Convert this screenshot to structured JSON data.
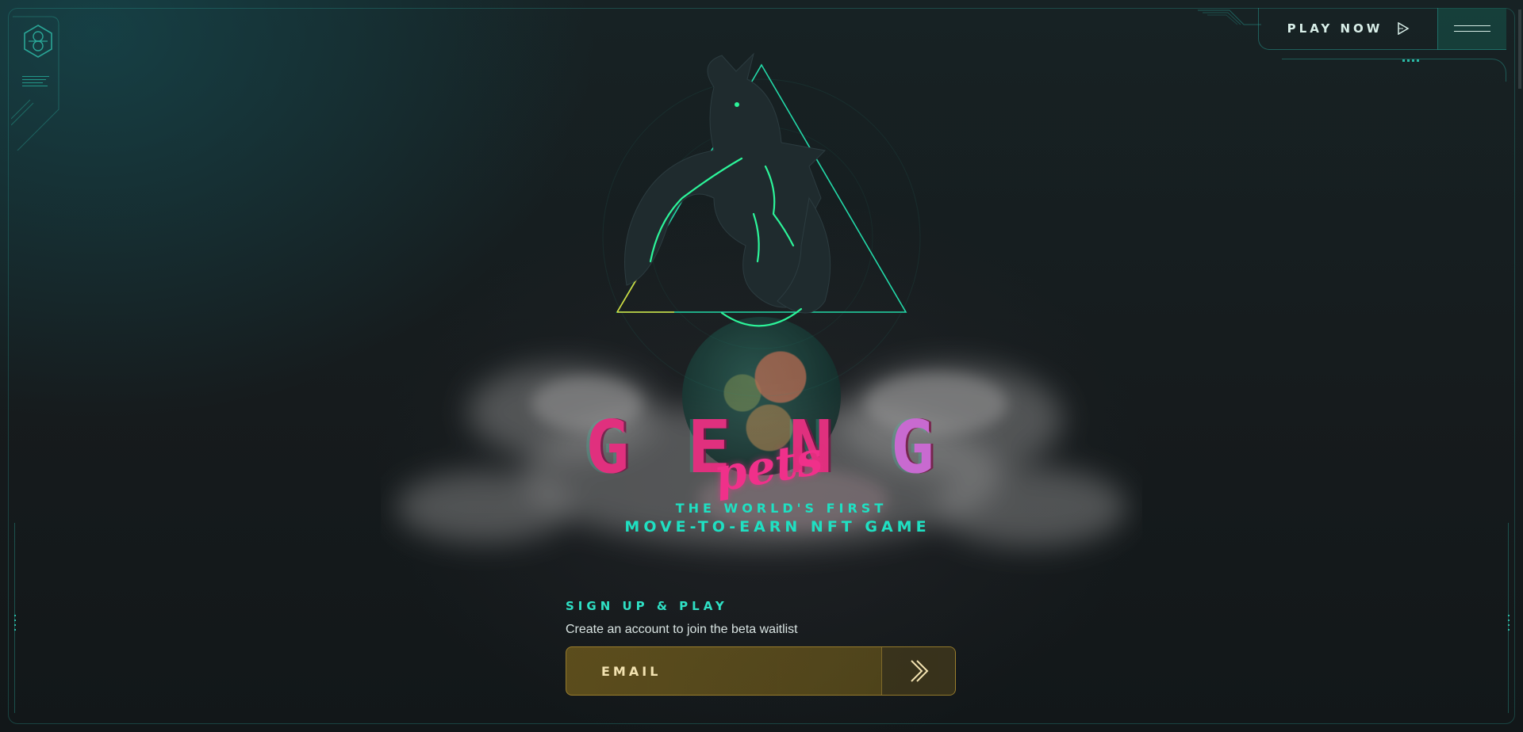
{
  "header": {
    "play_now_label": "PLAY NOW"
  },
  "hero": {
    "title_letters": [
      "G",
      "E",
      "N",
      "G"
    ],
    "title_script": "pets",
    "tagline_line1": "THE WORLD'S FIRST",
    "tagline_line2": "MOVE-TO-EARN NFT GAME"
  },
  "signup": {
    "heading": "SIGN UP & PLAY",
    "description": "Create an account to join the beta waitlist",
    "email_placeholder": "EMAIL"
  },
  "colors": {
    "accent_teal": "#1fe0c2",
    "title_pink": "#e0307e",
    "title_violet": "#c86ad0",
    "email_gold": "#967820"
  },
  "icons": {
    "logo": "hexagon-logo-icon",
    "play": "play-triangle-icon",
    "menu": "hamburger-menu-icon",
    "submit": "double-chevron-right-icon"
  }
}
